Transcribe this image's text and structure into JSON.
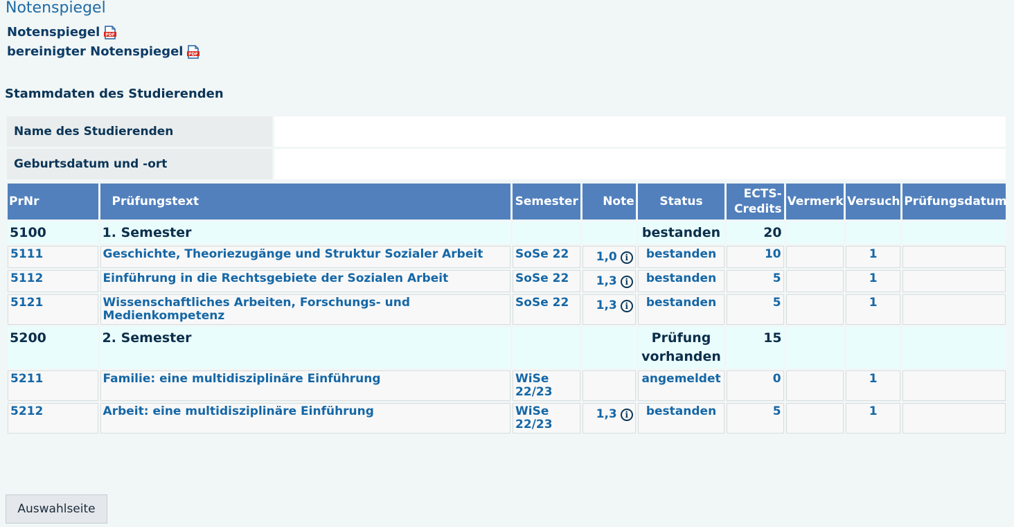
{
  "page": {
    "title": "Notenspiegel"
  },
  "links": {
    "notenspiegel": "Notenspiegel",
    "bereinigt": "bereinigter Notenspiegel",
    "pdf_badge": "PDF"
  },
  "stammdaten": {
    "title": "Stammdaten des Studierenden",
    "name_label": "Name des Studierenden",
    "name_value": "",
    "geburt_label": "Geburtsdatum und -ort",
    "geburt_value": ""
  },
  "table": {
    "headers": {
      "prnr": "PrNr",
      "text": "Prüfungstext",
      "semester": "Semester",
      "note": "Note",
      "status": "Status",
      "ects": "ECTS-Credits",
      "vermerk": "Vermerk",
      "versuch": "Versuch",
      "datum": "Prüfungsdatum"
    },
    "rows": [
      {
        "prnr": "5100",
        "text": "1. Semester",
        "semester": "",
        "note": "",
        "status": "bestanden",
        "ects": "20",
        "vermerk": "",
        "versuch": "",
        "datum": ""
      },
      {
        "prnr": "5111",
        "text": "Geschichte, Theoriezugänge und Struktur Sozialer Arbeit",
        "semester": "SoSe 22",
        "note": "1,0",
        "status": "bestanden",
        "ects": "10",
        "vermerk": "",
        "versuch": "1",
        "datum": ""
      },
      {
        "prnr": "5112",
        "text": "Einführung in die Rechtsgebiete der Sozialen Arbeit",
        "semester": "SoSe 22",
        "note": "1,3",
        "status": "bestanden",
        "ects": "5",
        "vermerk": "",
        "versuch": "1",
        "datum": ""
      },
      {
        "prnr": "5121",
        "text": "Wissenschaftliches Arbeiten, Forschungs- und Medienkompetenz",
        "semester": "SoSe 22",
        "note": "1,3",
        "status": "bestanden",
        "ects": "5",
        "vermerk": "",
        "versuch": "1",
        "datum": ""
      },
      {
        "prnr": "5200",
        "text": "2. Semester",
        "semester": "",
        "note": "",
        "status": "Prüfung vorhanden",
        "ects": "15",
        "vermerk": "",
        "versuch": "",
        "datum": ""
      },
      {
        "prnr": "5211",
        "text": "Familie: eine multidisziplinäre Einführung",
        "semester": "WiSe 22/23",
        "note": "",
        "status": "angemeldet",
        "ects": "0",
        "vermerk": "",
        "versuch": "1",
        "datum": ""
      },
      {
        "prnr": "5212",
        "text": "Arbeit: eine multidisziplinäre Einführung",
        "semester": "WiSe 22/23",
        "note": "1,3",
        "status": "bestanden",
        "ects": "5",
        "vermerk": "",
        "versuch": "1",
        "datum": ""
      }
    ]
  },
  "buttons": {
    "auswahlseite": "Auswahlseite"
  },
  "icons": {
    "pdf": "pdf-icon",
    "info": "info-icon"
  },
  "colors": {
    "header_bg": "#5180bd",
    "link": "#1567a6",
    "semester_row_bg": "#eafdfd",
    "page_bg": "#f1f6f6"
  }
}
